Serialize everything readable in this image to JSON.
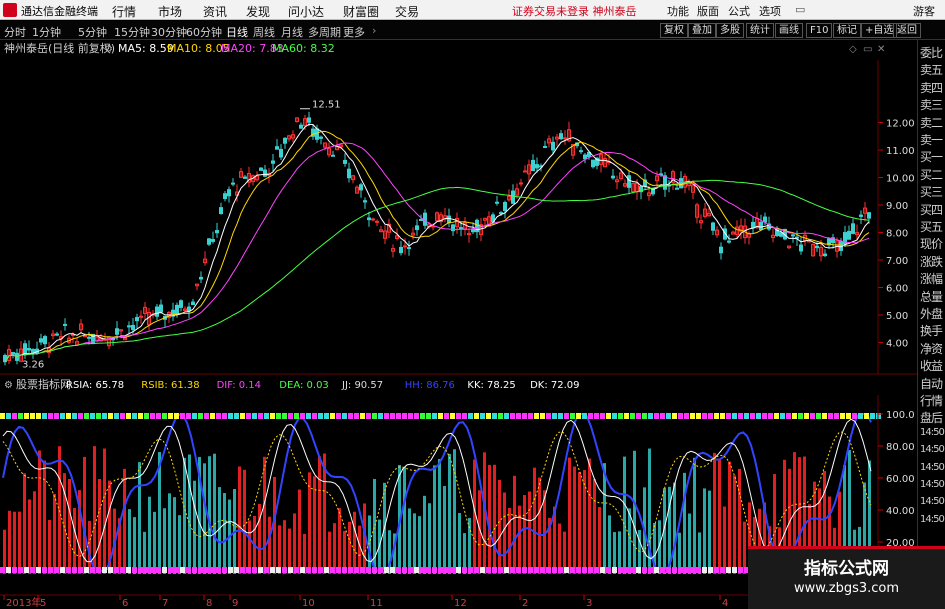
{
  "titlebar": {
    "app_title": "通达信金融终端",
    "menus": [
      "行情",
      "市场",
      "资讯",
      "发现",
      "问小达",
      "财富圈",
      "交易"
    ],
    "status_msg": "证券交易未登录 神州泰岳",
    "right_items": [
      "功能",
      "版面",
      "公式",
      "选项"
    ],
    "guest": "游客"
  },
  "periodbar": {
    "items": [
      "分时",
      "1分钟",
      "5分钟",
      "15分钟",
      "30分钟",
      "60分钟",
      "日线",
      "周线",
      "月线",
      "多周期",
      "更多"
    ],
    "active": "日线",
    "right_buttons": [
      "复权",
      "叠加",
      "多股",
      "统计",
      "画线",
      "F10",
      "标记",
      "+自选",
      "返回"
    ]
  },
  "main_panel": {
    "stock_label": "神州泰岳(日线 前复权)",
    "ma": [
      {
        "label": "MA5: 8.59",
        "color": "#ffffff"
      },
      {
        "label": "MA10: 8.05",
        "color": "#ffd700"
      },
      {
        "label": "MA20: 7.83",
        "color": "#ff44ff"
      },
      {
        "label": "MA60: 8.32",
        "color": "#44ff44"
      }
    ],
    "high_label": "12.51",
    "low_label": "3.26",
    "price_ticks": [
      "12.00",
      "11.00",
      "10.00",
      "9.00",
      "8.00",
      "7.00",
      "6.00",
      "5.00",
      "4.00"
    ],
    "price_tick_values": [
      12,
      11,
      10,
      9,
      8,
      7,
      6,
      5,
      4
    ]
  },
  "sub_panel": {
    "indicator_name": "股票指标网",
    "values": [
      {
        "label": "RSIA: 65.78",
        "color": "#ffffff"
      },
      {
        "label": "RSIB: 61.38",
        "color": "#ffd700"
      },
      {
        "label": "DIF: 0.14",
        "color": "#ff44ff"
      },
      {
        "label": "DEA: 0.03",
        "color": "#44ff44"
      },
      {
        "label": "JJ: 90.57",
        "color": "#dddddd"
      },
      {
        "label": "HH: 86.76",
        "color": "#3344ff"
      },
      {
        "label": "KK: 78.25",
        "color": "#ffffff"
      },
      {
        "label": "DK: 72.09",
        "color": "#ffffff"
      }
    ],
    "ticks": [
      "100.0",
      "80.00",
      "60.00",
      "40.00",
      "20.00"
    ],
    "tick_values": [
      100,
      80,
      60,
      40,
      20
    ]
  },
  "time_axis": [
    "2013年",
    "5",
    "6",
    "7",
    "8",
    "9",
    "10",
    "11",
    "12",
    "2",
    "3",
    "4"
  ],
  "side_panel": [
    "委比",
    "卖五",
    "卖四",
    "卖三",
    "卖二",
    "卖一",
    "买一",
    "买二",
    "买三",
    "买四",
    "买五",
    "现价",
    "涨跌",
    "涨幅",
    "总量",
    "外盘",
    "换手",
    "净资",
    "收益",
    "自动",
    "行情",
    "盘后",
    "14:50",
    "14:50",
    "14:50",
    "14:50",
    "14:50",
    "14:50"
  ],
  "watermark": {
    "line1": "指标公式网",
    "line2": "www.zbgs3.com"
  }
}
